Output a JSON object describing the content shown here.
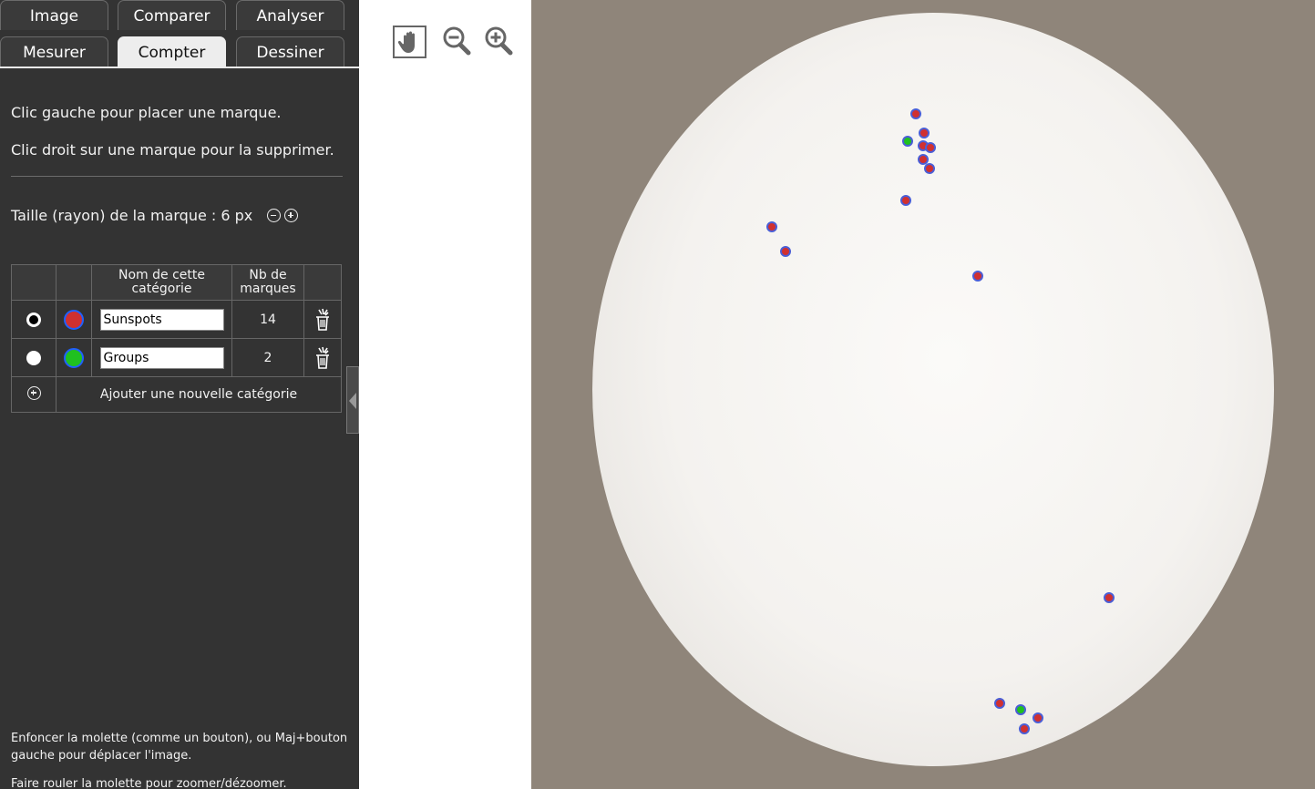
{
  "tabs": {
    "row1": [
      "Image",
      "Comparer",
      "Analyser"
    ],
    "row2": [
      "Mesurer",
      "Compter",
      "Dessiner"
    ],
    "active": "Compter"
  },
  "instructions": {
    "line1": "Clic gauche pour placer une marque.",
    "line2": "Clic droit sur une marque pour la supprimer."
  },
  "mark_size": {
    "label": "Taille (rayon) de la marque : 6 px"
  },
  "table": {
    "headers": {
      "name": "Nom de cette catégorie",
      "count": "Nb de marques"
    },
    "categories": [
      {
        "name": "Sunspots",
        "count": "14",
        "selected": true,
        "color": "#d03030"
      },
      {
        "name": "Groups",
        "count": "2",
        "selected": false,
        "color": "#20c020"
      }
    ],
    "add_label": "Ajouter une nouvelle catégorie"
  },
  "help": {
    "line1": "Enfoncer la molette (comme un bouton), ou Maj+bouton gauche pour déplacer l'image.",
    "line2": "Faire rouler la molette pour zoomer/dézoomer."
  },
  "colors": {
    "panel_bg": "#333333",
    "mark_border": "#4a5ed6",
    "sunspot_fill": "#d03030",
    "group_fill": "#20c020"
  },
  "icons": [
    "pan-hand-icon",
    "zoom-out-icon",
    "zoom-in-icon",
    "trash-icon",
    "add-circle-icon",
    "collapse-arrow-icon"
  ]
}
